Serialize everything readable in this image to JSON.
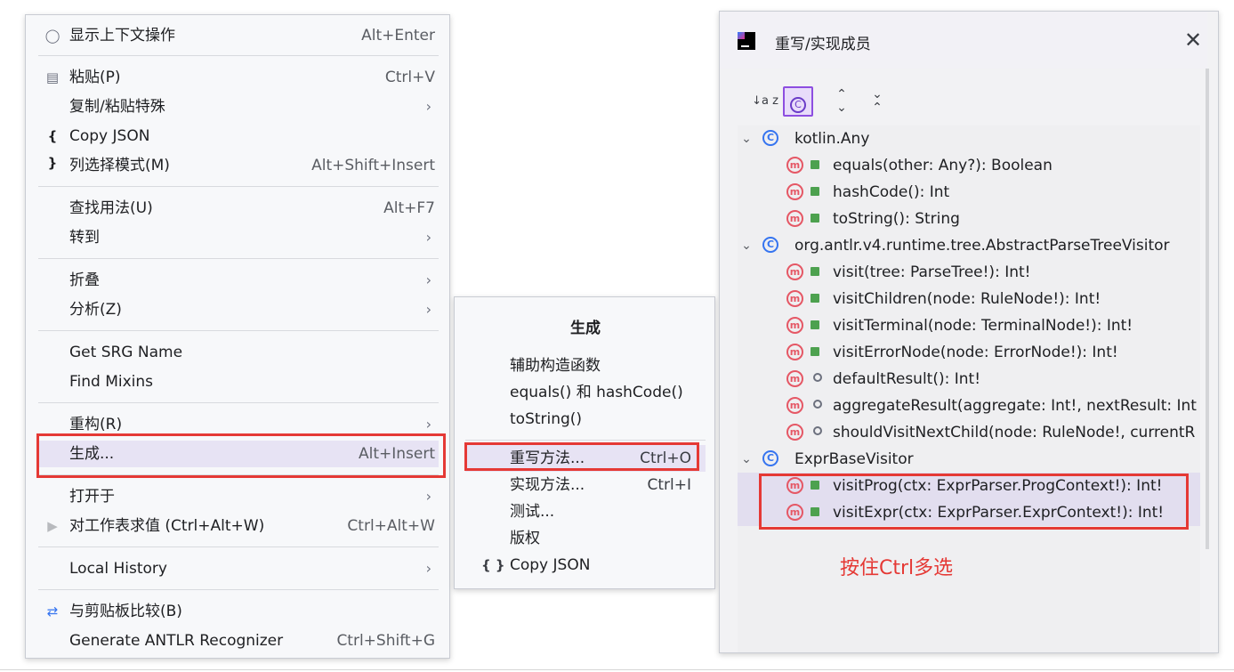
{
  "context_menu": {
    "items": [
      {
        "icon": "lightbulb-icon",
        "label": "显示上下文操作",
        "shortcut": "Alt+Enter"
      },
      {
        "icon": "clipboard-icon",
        "label": "粘贴(P)",
        "shortcut": "Ctrl+V"
      },
      {
        "label": "复制/粘贴特殊",
        "submenu": true
      },
      {
        "icon": "braces-icon",
        "label": "Copy JSON"
      },
      {
        "label": "列选择模式(M)",
        "shortcut": "Alt+Shift+Insert"
      },
      {
        "label": "查找用法(U)",
        "shortcut": "Alt+F7"
      },
      {
        "label": "转到",
        "submenu": true
      },
      {
        "label": "折叠",
        "submenu": true
      },
      {
        "label": "分析(Z)",
        "submenu": true
      },
      {
        "label": "Get SRG Name"
      },
      {
        "label": "Find Mixins"
      },
      {
        "label": "重构(R)",
        "submenu": true
      },
      {
        "label": "生成...",
        "shortcut": "Alt+Insert",
        "selected": true
      },
      {
        "label": "打开于",
        "submenu": true
      },
      {
        "icon": "play-icon",
        "label": "对工作表求值 (Ctrl+Alt+W)",
        "shortcut": "Ctrl+Alt+W"
      },
      {
        "label": "Local History",
        "submenu": true
      },
      {
        "icon": "compare-clipboard-icon",
        "label": "与剪贴板比较(B)"
      },
      {
        "label": "Generate ANTLR Recognizer",
        "shortcut": "Ctrl+Shift+G"
      }
    ],
    "arrow": "›",
    "braces": "{ }"
  },
  "generate_menu": {
    "title": "生成",
    "items": [
      {
        "label": "辅助构造函数"
      },
      {
        "label": "equals() 和 hashCode()"
      },
      {
        "label": "toString()"
      },
      {
        "label": "重写方法...",
        "shortcut": "Ctrl+O",
        "selected": true
      },
      {
        "label": "实现方法...",
        "shortcut": "Ctrl+I"
      },
      {
        "label": "测试..."
      },
      {
        "label": "版权"
      },
      {
        "icon": "braces-icon",
        "label": "Copy JSON"
      }
    ]
  },
  "override_dialog": {
    "title": "重写/实现成员",
    "close": "✕",
    "toolbar": {
      "sort": "↓a z",
      "show_classes": "C",
      "expand": "⌃⌄",
      "collapse": "⌄⌃"
    },
    "groups": [
      {
        "name": "kotlin.Any",
        "methods": [
          {
            "vis": "public",
            "sig": "equals(other: Any?): Boolean"
          },
          {
            "vis": "public",
            "sig": "hashCode(): Int"
          },
          {
            "vis": "public",
            "sig": "toString(): String"
          }
        ]
      },
      {
        "name": "org.antlr.v4.runtime.tree.AbstractParseTreeVisitor",
        "methods": [
          {
            "vis": "public",
            "sig": "visit(tree: ParseTree!): Int!"
          },
          {
            "vis": "public",
            "sig": "visitChildren(node: RuleNode!): Int!"
          },
          {
            "vis": "public",
            "sig": "visitTerminal(node: TerminalNode!): Int!"
          },
          {
            "vis": "public",
            "sig": "visitErrorNode(node: ErrorNode!): Int!"
          },
          {
            "vis": "protected",
            "sig": "defaultResult(): Int!"
          },
          {
            "vis": "protected",
            "sig": "aggregateResult(aggregate: Int!, nextResult: Int"
          },
          {
            "vis": "protected",
            "sig": "shouldVisitNextChild(node: RuleNode!, currentR"
          }
        ]
      },
      {
        "name": "ExprBaseVisitor",
        "methods": [
          {
            "vis": "public",
            "sig": "visitProg(ctx: ExprParser.ProgContext!): Int!",
            "selected": true
          },
          {
            "vis": "public",
            "sig": "visitExpr(ctx: ExprParser.ExprContext!): Int!",
            "selected": true
          }
        ]
      }
    ],
    "class_icon": "C",
    "method_icon": "m",
    "chevron": "⌄"
  },
  "annotation": {
    "text": "按住Ctrl多选",
    "color": "#e53935"
  }
}
